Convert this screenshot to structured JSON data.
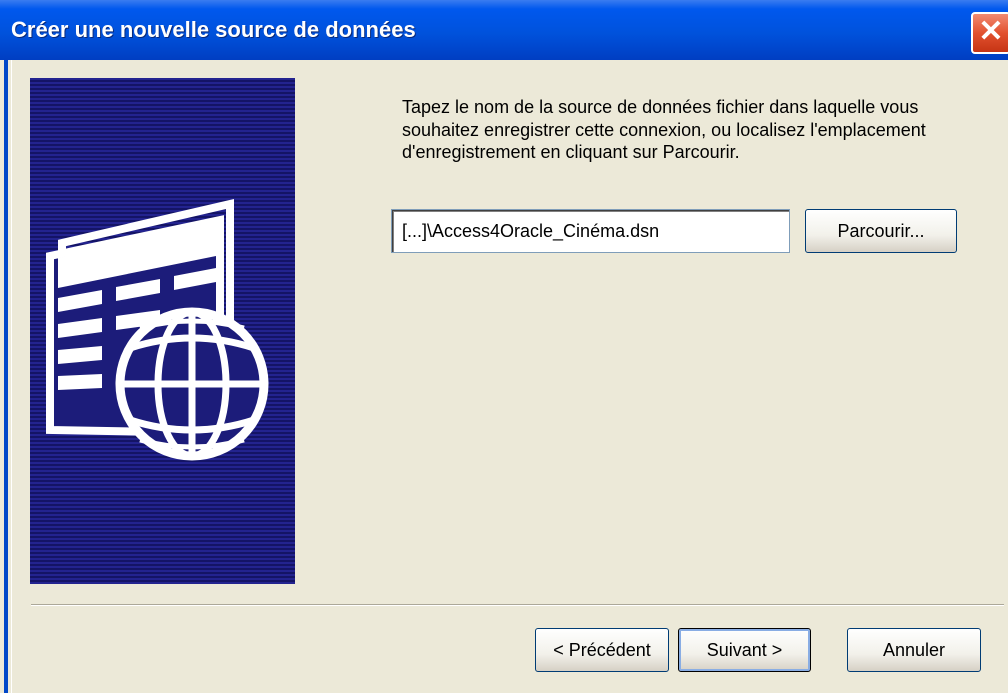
{
  "window": {
    "title": "Créer une nouvelle source de données",
    "close_glyph": "✕"
  },
  "banner": {
    "icon": "data-source-globe-icon",
    "background_color": "#1c1c7a"
  },
  "main": {
    "instructions": "Tapez le nom de la source de données fichier dans laquelle vous souhaitez enregistrer cette connexion, ou localisez l'emplacement d'enregistrement en cliquant sur Parcourir.",
    "filename_value": "[...]\\Access4Oracle_Cinéma.dsn",
    "browse_label": "Parcourir..."
  },
  "footer": {
    "prev_label": "< Précédent",
    "next_label": "Suivant >",
    "cancel_label": "Annuler"
  },
  "colors": {
    "titlebar": "#0054e3",
    "close_button": "#e2512f",
    "dialog_background": "#ece9d8",
    "button_border": "#003c74"
  }
}
